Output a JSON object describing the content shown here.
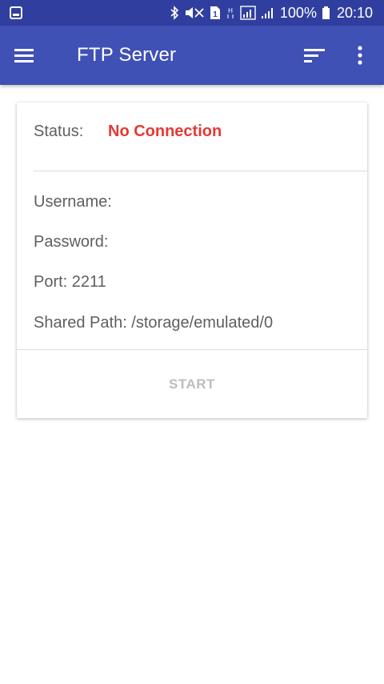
{
  "status_bar": {
    "battery": "100%",
    "time": "20:10",
    "icons": [
      "gallery-notification-icon",
      "bluetooth-icon",
      "mute-icon",
      "sim-1-icon",
      "h-plus-icon",
      "signal-1-icon",
      "signal-2-icon",
      "battery-icon"
    ]
  },
  "app_bar": {
    "title": "FTP Server",
    "icons": [
      "menu-icon",
      "sort-icon",
      "more-vert-icon"
    ]
  },
  "card": {
    "status_label": "Status:",
    "status_value": "No Connection",
    "username_label": "Username:",
    "password_label": "Password:",
    "port_text": "Port: 2211",
    "shared_path_text": "Shared Path: /storage/emulated/0",
    "start_label": "START"
  },
  "colors": {
    "status_bar": "#303f9f",
    "app_bar": "#3f51b5",
    "error": "#e53935",
    "disabled_text": "#bdbdbd"
  }
}
